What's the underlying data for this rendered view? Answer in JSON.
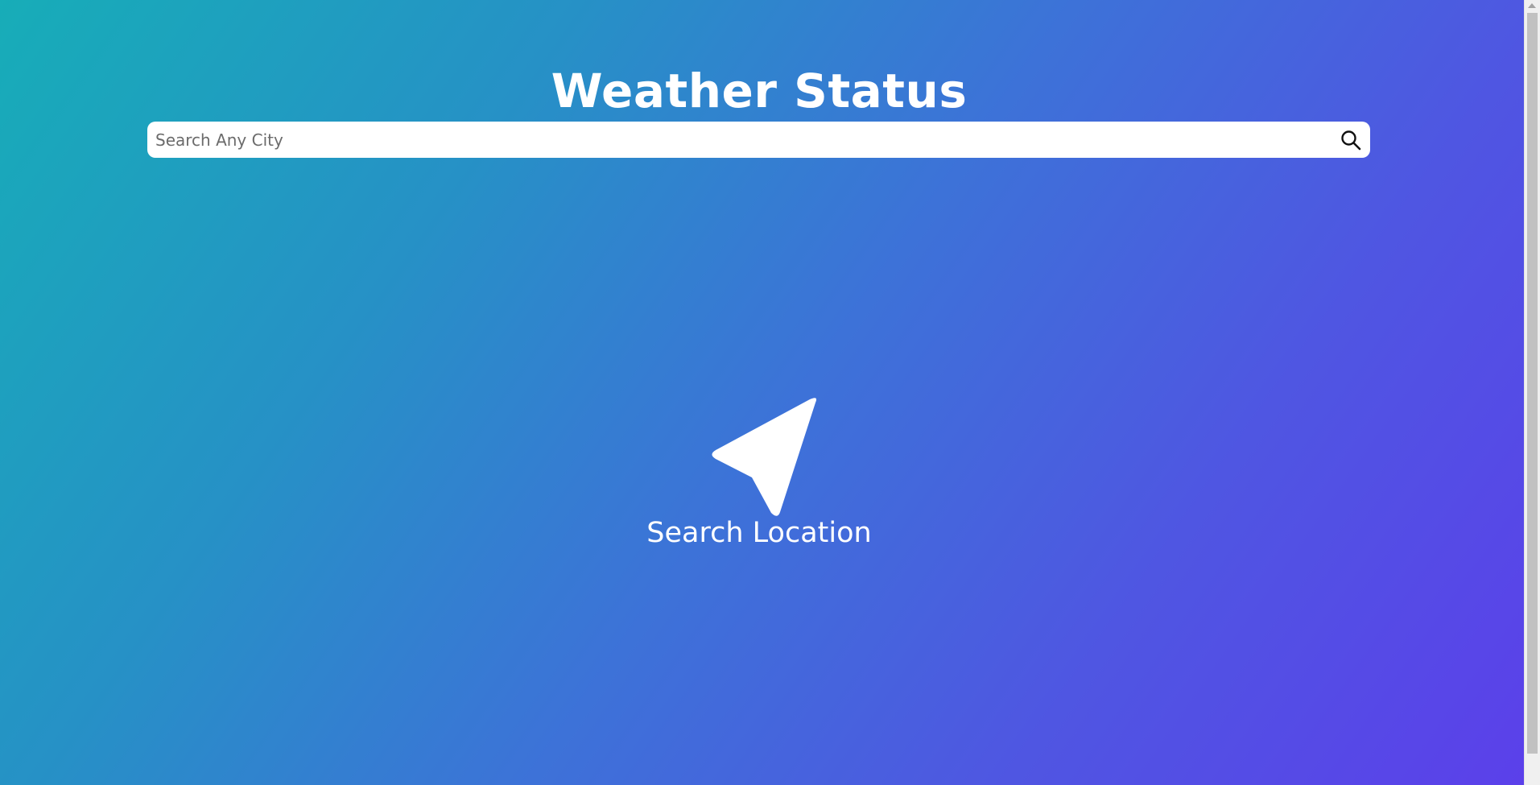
{
  "header": {
    "title": "Weather Status"
  },
  "search": {
    "placeholder": "Search Any City",
    "value": "",
    "button_icon": "search-icon"
  },
  "empty_state": {
    "icon": "navigation-arrow-icon",
    "label": "Search Location"
  },
  "colors": {
    "gradient_start": "#17adb8",
    "gradient_end": "#5b40ea",
    "text": "#ffffff",
    "search_bg": "#ffffff"
  }
}
